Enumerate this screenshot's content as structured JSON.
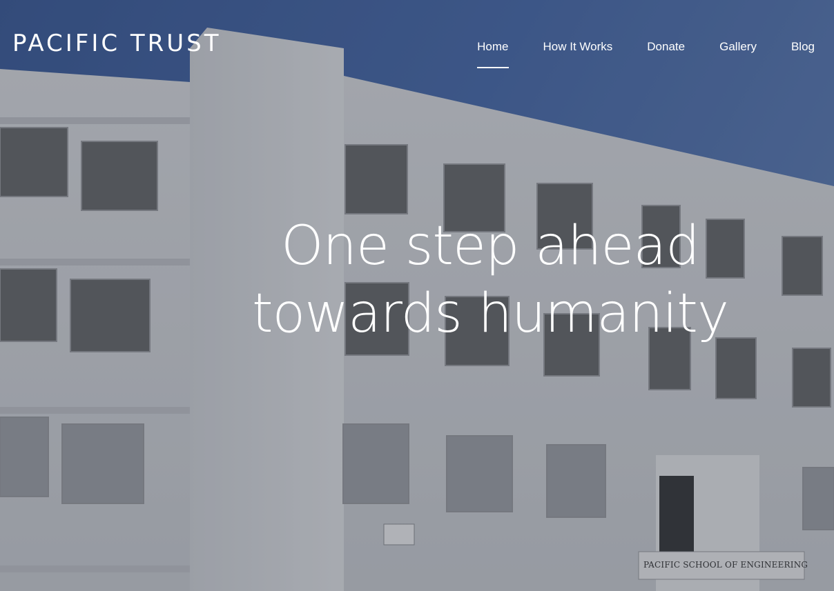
{
  "site": {
    "brand": "PACIFIC TRUST"
  },
  "nav": {
    "items": [
      {
        "label": "Home",
        "active": true
      },
      {
        "label": "How It Works",
        "active": false
      },
      {
        "label": "Donate",
        "active": false
      },
      {
        "label": "Gallery",
        "active": false
      },
      {
        "label": "Blog",
        "active": false
      }
    ]
  },
  "hero": {
    "heading": "One step ahead towards humanity",
    "building_sign": "PACIFIC SCHOOL OF ENGINEERING"
  },
  "colors": {
    "text": "#ffffff",
    "sky": "#4f6fa8",
    "building": "#d9dde3"
  }
}
